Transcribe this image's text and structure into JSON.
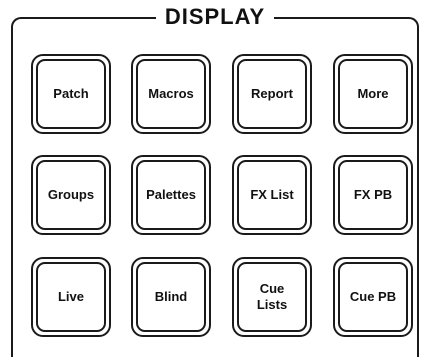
{
  "panel": {
    "title": "DISPLAY"
  },
  "keys": [
    {
      "label": "Patch"
    },
    {
      "label": "Macros"
    },
    {
      "label": "Report"
    },
    {
      "label": "More"
    },
    {
      "label": "Groups"
    },
    {
      "label": "Palettes"
    },
    {
      "label": "FX List"
    },
    {
      "label": "FX PB"
    },
    {
      "label": "Live"
    },
    {
      "label": "Blind"
    },
    {
      "label": "Cue\nLists"
    },
    {
      "label": "Cue PB"
    }
  ]
}
